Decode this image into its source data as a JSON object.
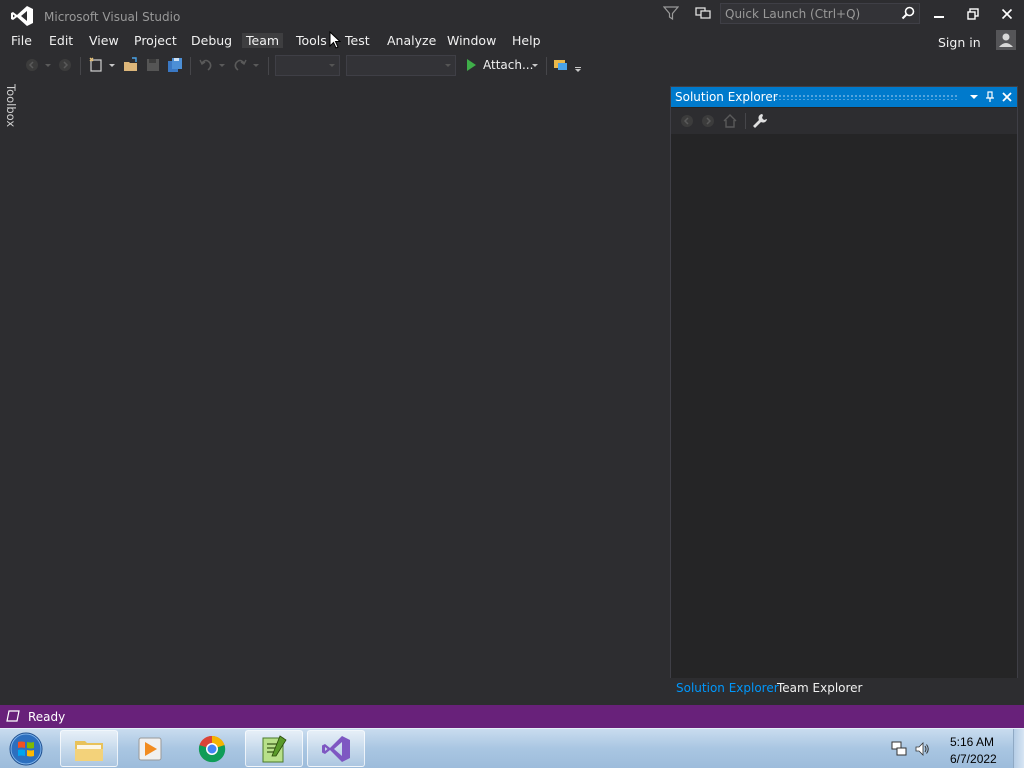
{
  "window": {
    "title": "Microsoft Visual Studio",
    "quick_launch_placeholder": "Quick Launch (Ctrl+Q)",
    "sign_in": "Sign in"
  },
  "menu": {
    "items": [
      {
        "label": "File"
      },
      {
        "label": "Edit"
      },
      {
        "label": "View"
      },
      {
        "label": "Project"
      },
      {
        "label": "Debug"
      },
      {
        "label": "Team"
      },
      {
        "label": "Tools"
      },
      {
        "label": "Test"
      },
      {
        "label": "Analyze"
      },
      {
        "label": "Window"
      },
      {
        "label": "Help"
      }
    ]
  },
  "toolbar": {
    "attach_label": "Attach..."
  },
  "toolbox": {
    "label": "Toolbox"
  },
  "solution_explorer": {
    "title": "Solution Explorer",
    "tabs": [
      {
        "label": "Solution Explorer",
        "active": true
      },
      {
        "label": "Team Explorer",
        "active": false
      }
    ]
  },
  "status": {
    "text": "Ready"
  },
  "taskbar": {
    "time": "5:16 AM",
    "date": "6/7/2022"
  },
  "colors": {
    "accent": "#007acc",
    "status_bar": "#68217a",
    "background": "#2d2d30"
  }
}
